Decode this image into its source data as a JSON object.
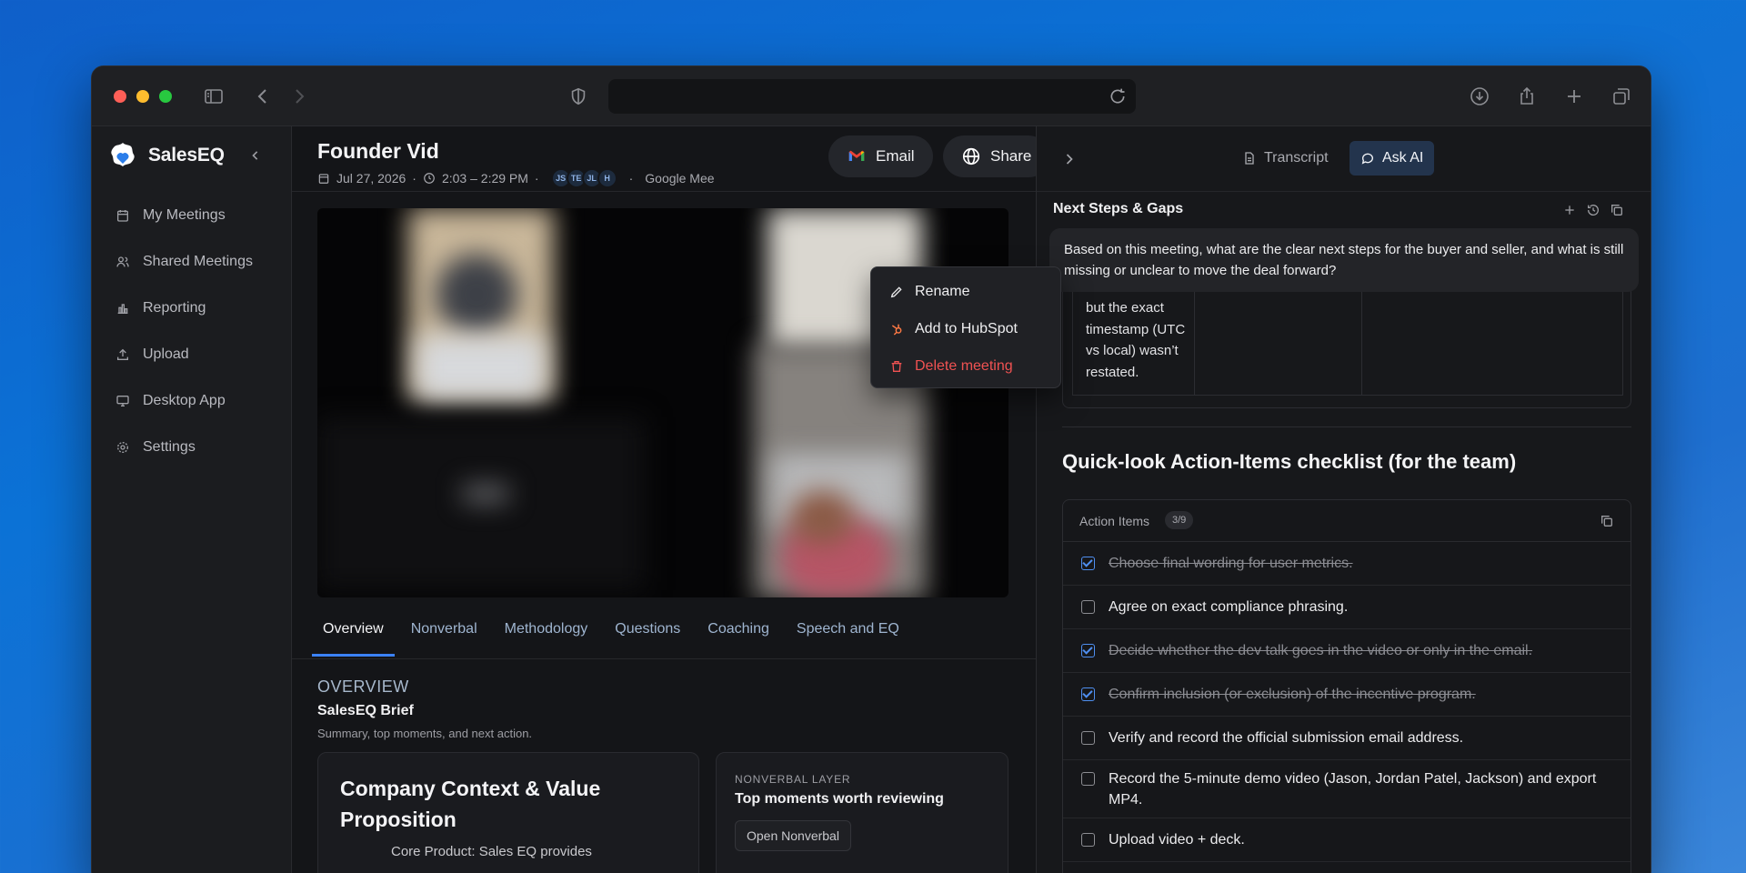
{
  "sidebar": {
    "brand": "SalesEQ",
    "items": [
      {
        "label": "My Meetings"
      },
      {
        "label": "Shared Meetings"
      },
      {
        "label": "Reporting"
      },
      {
        "label": "Upload"
      },
      {
        "label": "Desktop App"
      },
      {
        "label": "Settings"
      }
    ]
  },
  "meeting": {
    "title": "Founder Vid",
    "date": "Jul 27, 2026",
    "time": "2:03 – 2:29 PM",
    "participants": [
      "JS",
      "TE",
      "JL",
      "H"
    ],
    "source": "Google Mee"
  },
  "header_actions": {
    "email_label": "Email",
    "share_label": "Share"
  },
  "menu": {
    "rename": "Rename",
    "hubspot": "Add to HubSpot",
    "delete": "Delete meeting"
  },
  "video": {
    "overlay_text": "mm"
  },
  "tabs": [
    "Overview",
    "Nonverbal",
    "Methodology",
    "Questions",
    "Coaching",
    "Speech and EQ"
  ],
  "overview": {
    "section_label": "OVERVIEW",
    "title": "SalesEQ Brief",
    "subtitle": "Summary, top moments, and next action.",
    "card1_title": "Company Context & Value Proposition",
    "card1_body": "Core Product: Sales EQ provides",
    "card2_kicker": "NONVERBAL LAYER",
    "card2_title": "Top moments worth reviewing",
    "card2_button": "Open Nonverbal"
  },
  "right_panel": {
    "tab_transcript": "Transcript",
    "tab_ask_ai": "Ask AI",
    "thread_title": "Next Steps & Gaps",
    "prompt": "Based on this meeting, what are the clear next steps for the buyer and seller, and what is still missing or unclear to move the deal forward?",
    "table_cell_text": "but the exact timestamp (UTC vs local) wasn’t restated.",
    "checklist_title": "Quick-look Action-Items checklist (for the team)",
    "action_items_label": "Action Items",
    "action_items_count": "3/9",
    "items": [
      {
        "text": "Choose final wording for user metrics.",
        "done": true
      },
      {
        "text": "Agree on exact compliance phrasing.",
        "done": false
      },
      {
        "text": "Decide whether the dev talk goes in the video or only in the email.",
        "done": true
      },
      {
        "text": "Confirm inclusion (or exclusion) of the incentive program.",
        "done": true
      },
      {
        "text": "Verify and record the official submission email address.",
        "done": false
      },
      {
        "text": "Record the 5-minute demo video (Jason, Jordan Patel, Jackson) and export MP4.",
        "done": false
      },
      {
        "text": "Upload video + deck.",
        "done": false
      }
    ]
  },
  "colors": {
    "accent": "#3b82f6",
    "danger": "#f05252",
    "hubspot": "#ff7a45"
  }
}
